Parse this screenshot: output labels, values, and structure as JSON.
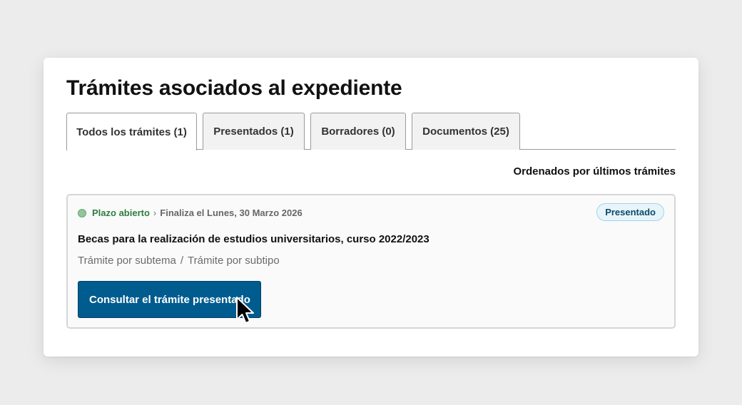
{
  "page": {
    "title": "Trámites asociados al expediente"
  },
  "tabs": [
    {
      "label": "Todos los trámites (1)",
      "active": true
    },
    {
      "label": "Presentados (1)",
      "active": false
    },
    {
      "label": "Borradores (0)",
      "active": false
    },
    {
      "label": "Documentos (25)",
      "active": false
    }
  ],
  "sort": {
    "label": "Ordenados por últimos trámites"
  },
  "item": {
    "status": "Plazo abierto",
    "separator": "›",
    "deadline": "Finaliza el Lunes, 30 Marzo 2026",
    "badge": "Presentado",
    "title": "Becas para la realización de estudios universitarios, curso 2022/2023",
    "subtheme": "Trámite por subtema",
    "meta_separator": "/",
    "subtype": "Trámite por subtipo",
    "action_label": "Consultar el trámite presentado"
  },
  "colors": {
    "primary": "#005c8e",
    "status_open": "#2f7d3c",
    "badge_bg": "#e7f5fb"
  },
  "icons": {
    "status": "status-dot-icon",
    "cursor": "mouse-pointer-icon"
  }
}
